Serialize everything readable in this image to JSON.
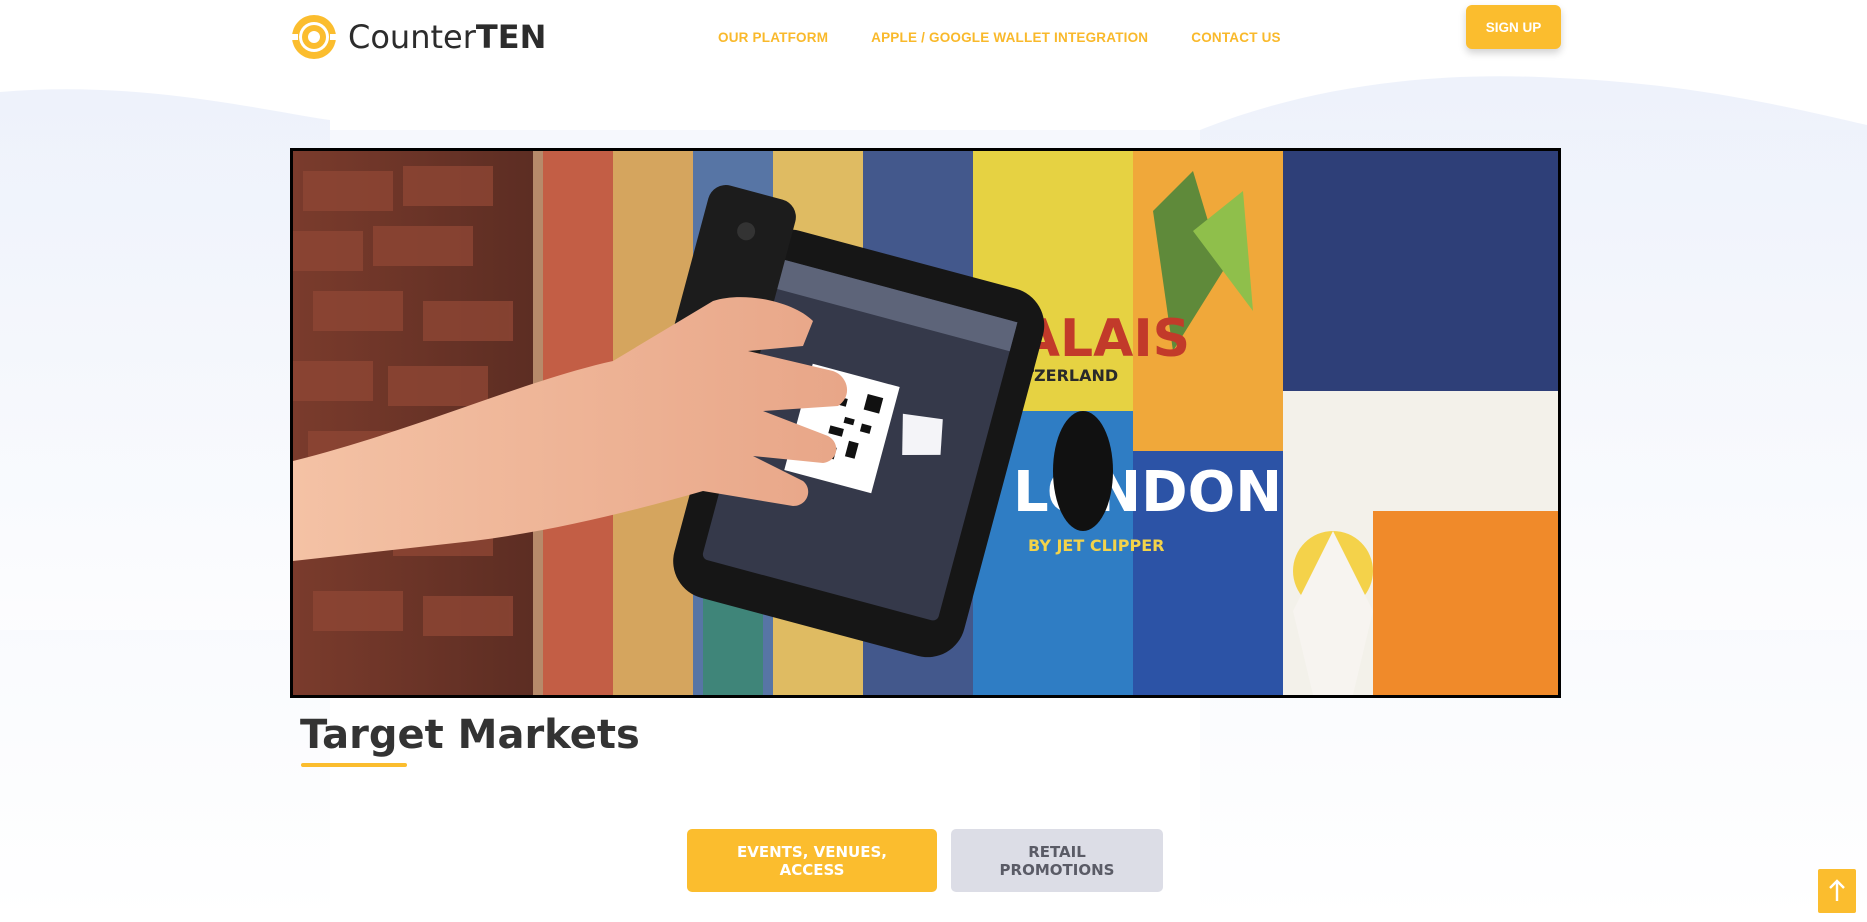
{
  "brand": {
    "name_light": "Counter",
    "name_bold": "TEN",
    "accent_color": "#fbbd2e"
  },
  "nav": {
    "items": [
      {
        "label": "OUR PLATFORM"
      },
      {
        "label": "APPLE / GOOGLE WALLET INTEGRATION"
      },
      {
        "label": "CONTACT US"
      }
    ],
    "signup_label": "SIGN UP"
  },
  "hero": {
    "image_alt": "Hand scanning a phone QR code at a tablet kiosk in front of a wall of travel posters",
    "poster_texts": [
      "VALAIS",
      "SWITZERLAND",
      "LONDON",
      "BY JET CLIPPER"
    ]
  },
  "section": {
    "title": "Target Markets"
  },
  "tabs": [
    {
      "label": "EVENTS, VENUES, ACCESS",
      "active": true
    },
    {
      "label": "RETAIL PROMOTIONS",
      "active": false
    }
  ],
  "scroll_top_icon": "arrow-up-icon"
}
